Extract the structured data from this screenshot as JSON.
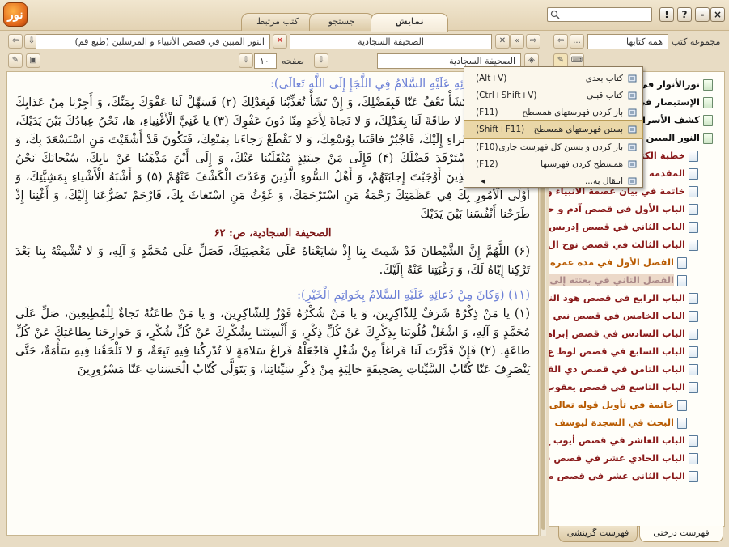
{
  "app": {
    "logo_text": "نور",
    "tabs": [
      {
        "label": "کتب مرتبط"
      },
      {
        "label": "جستجو"
      },
      {
        "label": "نمایش",
        "active": true
      }
    ],
    "window_buttons": {
      "close": "×",
      "minimize": "-",
      "help": "?",
      "info": "!"
    }
  },
  "left_toolbar": {
    "book_title_field": "النور المبين في قصص الأنبياء و المرسلين (طبع قم)",
    "book_title_field_2": "الصحيفة السجادية",
    "page_label": "صفحه",
    "page_value": "۱۰",
    "section_value": "الصحيفة السجادية"
  },
  "right_toolbar": {
    "collection_label": "مجموعه کتب",
    "collection_value": "همه کتابها",
    "more": "..."
  },
  "context_menu": {
    "items": [
      {
        "label": "کتاب بعدی",
        "shortcut": "(Alt+V)"
      },
      {
        "label": "کتاب قبلی",
        "shortcut": "(Ctrl+Shift+V)"
      },
      {
        "label": "باز کردن فهرستهای همسطح",
        "shortcut": "(F11)"
      },
      {
        "label": "بستن فهرستهای همسطح",
        "shortcut": "(Shift+F11)",
        "highlighted": true
      },
      {
        "label": "باز کردن و بستن کل فهرست جاری",
        "shortcut": "(F10)"
      },
      {
        "label": "همسطح کردن فهرستها",
        "shortcut": "(F12)"
      },
      {
        "label": "انتقال به...",
        "shortcut": ""
      }
    ]
  },
  "reader": {
    "lines": [
      {
        "text": "(وَكانَ مِنْ دُعائِهِ عَلَيْهِ السَّلامُ فِي اللَّجَإِ إِلَى اللَّهِ تَعالَى):",
        "style": "heading"
      },
      {
        "text": "(۱) اللَّهُمَّ إِنْ تَشَأْ تَعْفُ عَنّا فَبِفَضْلِكَ، وَ إِنْ تَشَأْ تُعَذِّبْنا فَبِعَدْلِكَ (۲) فَسَهِّلْ لَنا عَفْوَكَ بِمَنِّكَ، وَ أَجِرْنا مِنْ عَذابِكَ بِتَجاوُزِكَ، فَإِنَّهُ لا طاقَةَ لَنا بِعَدْلِكَ، وَ لا نَجاةَ لِأَحَدٍ مِنّا دُونَ عَفْوِكَ (۳) يا غَنِيَّ الْأَغْنِياءِ، ها، نَحْنُ عِبادُكَ بَيْنَ يَدَيْكَ، وَ أَنَا أَفْقَرُ الْفُقَراءِ إِلَيْكَ، فَاجْبُرْ فاقَتَنا بِوُسْعِكَ، وَ لا تَقْطَعْ رَجاءَنا بِمَنْعِكَ، فَتَكُونَ قَدْ أَشْقَيْتَ مَنِ اسْتَسْعَدَ بِكَ، وَ حَرَمْتَ مَنِ اسْتَرْفَدَ فَضْلَكَ (۴) فَإِلَى مَنْ حِينَئِذٍ مُنْقَلَبُنا عَنْكَ، وَ إِلَى أَيْنَ مَذْهَبُنا عَنْ بابِكَ، سُبْحانَكَ نَحْنُ الْمُضْطَرُّونَ الَّذِينَ أَوْجَبْتَ إِجابَتَهُمْ، وَ أَهْلُ السُّوءِ الَّذِينَ وَعَدْتَ الْكَشْفَ عَنْهُمْ (۵) وَ أَشْبَهُ الْأَشْياءِ بِمَشِيَّتِكَ، وَ أَوْلَى الْأُمُورِ بِكَ فِي عَظَمَتِكَ رَحْمَةُ مَنِ اسْتَرْحَمَكَ، وَ غَوْثُ مَنِ اسْتَغاثَ بِكَ، فَارْحَمْ تَضَرُّعَنا إِلَيْكَ، وَ أَغْنِنا إِذْ طَرَحْنا أَنْفُسَنا بَيْنَ يَدَيْكَ",
        "style": "normal"
      },
      {
        "text": "الصحيفة السجادية، ص: ۶۲",
        "style": "pageref"
      },
      {
        "text": "(۶) اللَّهُمَّ إِنَّ الشَّيْطانَ قَدْ شَمِتَ بِنا إِذْ شايَعْناهُ عَلَى مَعْصِيَتِكَ، فَصَلِّ عَلَى مُحَمَّدٍ وَ آلِهِ، وَ لا تُشْمِتْهُ بِنا بَعْدَ تَرْكِنا إِيّاهُ لَكَ، وَ رَغْبَتِنا عَنْهُ إِلَيْكَ.",
        "style": "normal"
      },
      {
        "text": "(۱۱) (وَكانَ مِنْ دُعائِهِ عَلَيْهِ السَّلامُ بِخَواتِمِ الْخَيْرِ):",
        "style": "heading"
      },
      {
        "text": "(۱) يا مَنْ ذِكْرُهُ شَرَفٌ لِلذّاكِرِينَ، وَ يا مَنْ شُكْرُهُ فَوْزٌ لِلشّاكِرِينَ، وَ يا مَنْ طاعَتُهُ نَجاةٌ لِلْمُطِيعِينَ، صَلِّ عَلَى مُحَمَّدٍ وَ آلِهِ، وَ اشْغَلْ قُلُوبَنا بِذِكْرِكَ عَنْ كُلِّ ذِكْرٍ، وَ أَلْسِنَتَنا بِشُكْرِكَ عَنْ كُلِّ شُكْرٍ، وَ جَوارِحَنا بِطاعَتِكَ عَنْ كُلِّ طاعَةٍ. (۲) فَإِنْ قَدَّرْتَ لَنا فَراغاً مِنْ شُغْلٍ فَاجْعَلْهُ فَراغَ سَلامَةٍ لا تُدْرِكُنا فِيهِ تَبِعَةٌ، وَ لا تَلْحَقُنا فِيهِ سَأْمَةٌ، حَتَّى يَنْصَرِفَ عَنّا كُتّابُ السَّيِّئاتِ بِصَحِيفَةٍ خالِيَةٍ مِنْ ذِكْرِ سَيِّئاتِنا، وَ يَتَوَلَّى كُتّابُ الْحَسَناتِ عَنّا مَسْرُورِينَ",
        "style": "normal"
      }
    ]
  },
  "tree": {
    "items": [
      {
        "label": "نورالأنوار في",
        "color": "black",
        "level": 0
      },
      {
        "label": "الإستبصار في",
        "color": "black",
        "level": 0
      },
      {
        "label": "كشف الأسرار",
        "color": "black",
        "level": 0
      },
      {
        "label": "النور المبين",
        "color": "black",
        "level": 0
      },
      {
        "label": "خطبة الكتاب",
        "color": "red",
        "level": 1
      },
      {
        "label": "المقدمة",
        "color": "red",
        "level": 1
      },
      {
        "label": "خاتمة في بيان عصمة الأنبياء و",
        "color": "red",
        "level": 1
      },
      {
        "label": "الباب الأول في قصص آدم و حو",
        "color": "red",
        "level": 1
      },
      {
        "label": "الباب الثاني في قصص إدريس",
        "color": "red",
        "level": 1
      },
      {
        "label": "الباب الثالث في قصص نوح ال",
        "color": "red",
        "level": 1
      },
      {
        "label": "الفصل الأول في مدة عمره و",
        "color": "orange",
        "level": 2
      },
      {
        "label": "الفصل الثاني في بعثته إلى",
        "color": "orange",
        "level": 2,
        "selected": true
      },
      {
        "label": "الباب الرابع في قصص هود النبي",
        "color": "red",
        "level": 1
      },
      {
        "label": "الباب الخامس في قصص نبي الل",
        "color": "red",
        "level": 1
      },
      {
        "label": "الباب السادس في قصص إبراهي",
        "color": "red",
        "level": 1
      },
      {
        "label": "الباب السابع في قصص لوط ع",
        "color": "red",
        "level": 1
      },
      {
        "label": "الباب الثامن في قصص ذي القر",
        "color": "red",
        "level": 1
      },
      {
        "label": "الباب التاسع في قصص يعقوب",
        "color": "red",
        "level": 1
      },
      {
        "label": "خاتمة في تأويل قوله تعالى",
        "color": "orange",
        "level": 2
      },
      {
        "label": "البحث في السجدة ليوسف",
        "color": "orange",
        "level": 2
      },
      {
        "label": "الباب العاشر في قصص أيوب ع",
        "color": "red",
        "level": 1
      },
      {
        "label": "الباب الحادي عشر في قصص ش",
        "color": "red",
        "level": 1
      },
      {
        "label": "الباب الثاني عشر في قصص مو",
        "color": "red",
        "level": 1
      }
    ]
  },
  "bottom_tabs": [
    {
      "label": "فهرست درختی",
      "active": true
    },
    {
      "label": "فهرست گزینشی"
    }
  ]
}
